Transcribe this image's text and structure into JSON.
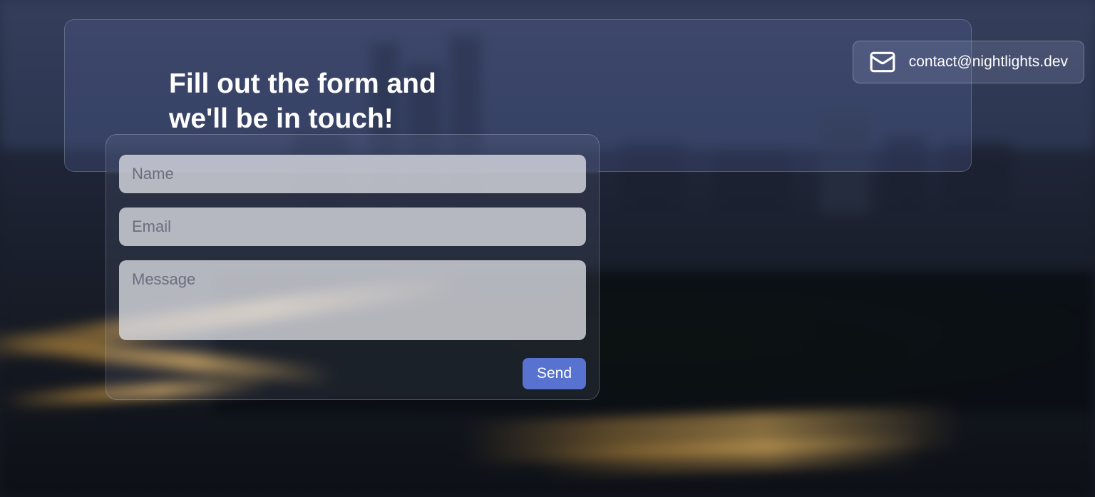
{
  "banner": {
    "heading_line1": "Fill out the form and",
    "heading_line2": "we'll be in touch!"
  },
  "contact": {
    "email": "contact@nightlights.dev"
  },
  "form": {
    "name_placeholder": "Name",
    "email_placeholder": "Email",
    "message_placeholder": "Message",
    "name_value": "",
    "email_value": "",
    "message_value": "",
    "send_label": "Send"
  },
  "colors": {
    "accent": "#5773cf",
    "panel_bg": "rgba(87,104,163,0.25)",
    "field_bg": "rgba(222,223,229,0.78)"
  }
}
